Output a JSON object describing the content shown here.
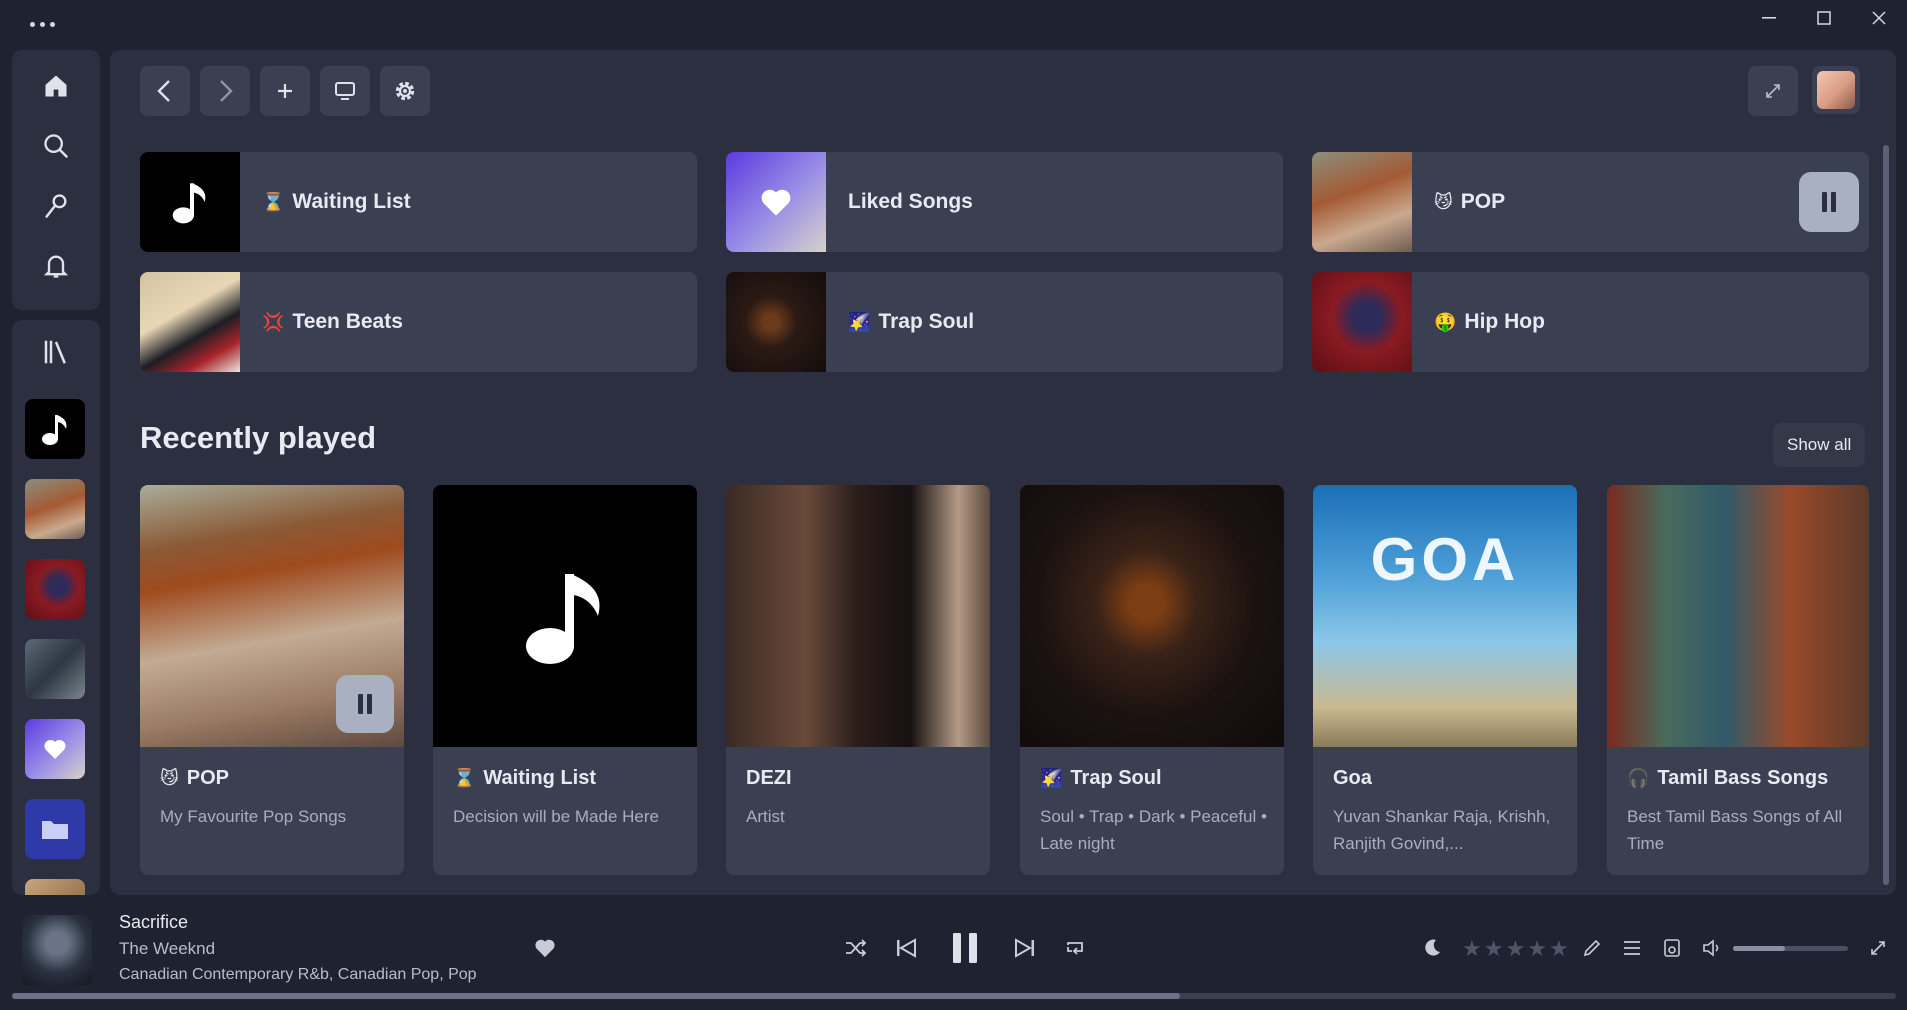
{
  "window": {
    "menu_icon": "more-dots-icon"
  },
  "sidebar": {
    "nav": [
      "home-icon",
      "search-icon",
      "explore-icon",
      "notifications-icon"
    ],
    "library_icon": "library-icon"
  },
  "toolbar": {
    "buttons": [
      "back-icon",
      "forward-icon",
      "add-icon",
      "device-icon",
      "settings-icon"
    ]
  },
  "quick_access": [
    {
      "emoji": "⌛",
      "label": "Waiting List"
    },
    {
      "emoji": "",
      "label": "Liked Songs"
    },
    {
      "emoji": "😼",
      "label": "POP"
    },
    {
      "emoji": "💢",
      "label": "Teen Beats"
    },
    {
      "emoji": "🌠",
      "label": "Trap Soul"
    },
    {
      "emoji": "🤑",
      "label": "Hip Hop"
    }
  ],
  "recent": {
    "title": "Recently played",
    "show_all": "Show all",
    "cards": [
      {
        "emoji": "😼",
        "title": "POP",
        "subtitle": "My Favourite Pop Songs"
      },
      {
        "emoji": "⌛",
        "title": "Waiting List",
        "subtitle": "Decision will be Made Here"
      },
      {
        "emoji": "",
        "title": "DEZI",
        "subtitle": "Artist"
      },
      {
        "emoji": "🌠",
        "title": "Trap Soul",
        "subtitle": "Soul • Trap • Dark • Peaceful • Late night"
      },
      {
        "emoji": "",
        "title": "Goa",
        "subtitle": "Yuvan Shankar Raja, Krishh, Ranjith Govind,..."
      },
      {
        "emoji": "🎧",
        "title": "Tamil Bass Songs",
        "subtitle": "Best Tamil Bass Songs of All Time"
      }
    ]
  },
  "album_art_text": {
    "goa": "GOA"
  },
  "now_playing": {
    "title": "Sacrifice",
    "artist": "The Weeknd",
    "genres": "Canadian Contemporary R&b, Canadian Pop, Pop",
    "progress": 0.62,
    "volume": 0.45,
    "rating_stars": 5
  },
  "colors": {
    "accent": "#a9b0c2",
    "background": "#1f2230",
    "panel": "#2b2f40",
    "tile": "#3a3f52"
  }
}
